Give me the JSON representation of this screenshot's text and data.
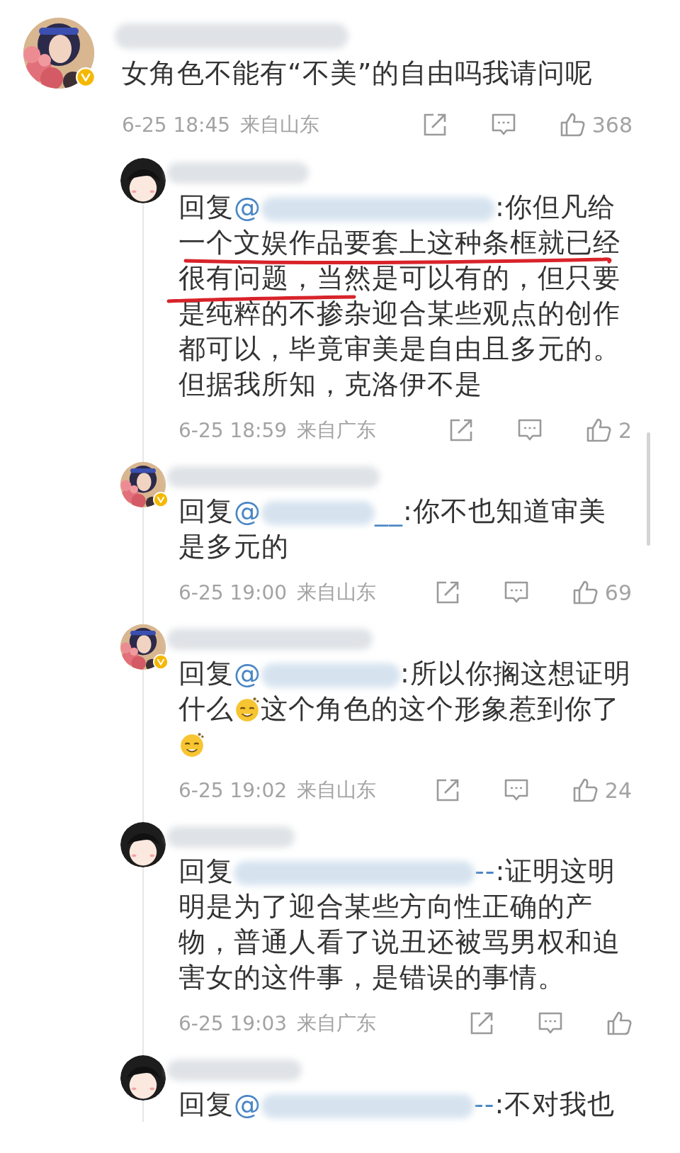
{
  "comment": {
    "verified": true,
    "text": "女角色不能有“不美”的自由吗我请问呢",
    "time": "6-25 18:45",
    "location": "来自山东",
    "likes": "368"
  },
  "replies": [
    {
      "verified": false,
      "reply_label": "回复",
      "at": "@",
      "body": [
        {
          "kind": "text",
          "text": ":你但凡给一个文娱作品要套上这种条框就已经很有问题，当然是可以有的，但只要是纯粹的不掺杂迎合某些观点的创作都可以，毕竟审美是自由且多元的。但据我所知，克洛伊不是"
        }
      ],
      "underlined": true,
      "time": "6-25 18:59",
      "location": "来自广东",
      "likes": "2"
    },
    {
      "verified": true,
      "reply_label": "回复",
      "at": "@",
      "mention_tail": "__",
      "body": [
        {
          "kind": "text",
          "text": ":你不也知道审美是多元的"
        }
      ],
      "underlined": false,
      "time": "6-25 19:00",
      "location": "来自山东",
      "likes": "69"
    },
    {
      "verified": true,
      "reply_label": "回复",
      "at": "@",
      "body": [
        {
          "kind": "text",
          "text": ":所以你搁这想证明什么"
        },
        {
          "kind": "emoji"
        },
        {
          "kind": "text",
          "text": "这个角色的这个形象惹到你了"
        },
        {
          "kind": "emoji"
        }
      ],
      "underlined": false,
      "time": "6-25 19:02",
      "location": "来自山东",
      "likes": "24"
    },
    {
      "verified": false,
      "reply_label": "回复",
      "mention_tail": "--",
      "body": [
        {
          "kind": "text",
          "text": ":证明这明明是为了迎合某些方向性正确的产物，普通人看了说丑还被骂男权和迫害女的这件事，是错误的事情。"
        }
      ],
      "underlined": false,
      "time": "6-25 19:03",
      "location": "来自广东"
    },
    {
      "verified": false,
      "reply_label": "回复",
      "at": "@",
      "mention_tail": "--",
      "body": [
        {
          "kind": "text",
          "text": ":不对我也"
        }
      ],
      "underlined": false
    }
  ]
}
